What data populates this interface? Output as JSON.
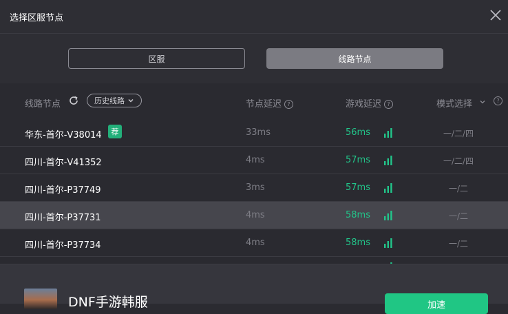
{
  "window": {
    "title": "选择区服节点"
  },
  "tabs": [
    {
      "label": "区服",
      "active": false
    },
    {
      "label": "线路节点",
      "active": true
    }
  ],
  "list_header": {
    "route_label": "线路节点",
    "history_label": "历史线路",
    "node_latency_label": "节点延迟",
    "game_latency_label": "游戏延迟",
    "mode_label": "模式选择",
    "help_glyph": "?"
  },
  "rows": [
    {
      "name": "华东-首尔-V38014",
      "recommended": true,
      "badge": "荐",
      "node_latency": "33ms",
      "game_latency": "56ms",
      "mode": "一/二/四",
      "highlighted": false
    },
    {
      "name": "四川-首尔-V41352",
      "recommended": false,
      "node_latency": "4ms",
      "game_latency": "57ms",
      "mode": "一/二/四",
      "highlighted": false
    },
    {
      "name": "四川-首尔-P37749",
      "recommended": false,
      "node_latency": "3ms",
      "game_latency": "57ms",
      "mode": "一/二",
      "highlighted": false
    },
    {
      "name": "四川-首尔-P37731",
      "recommended": false,
      "node_latency": "4ms",
      "game_latency": "58ms",
      "mode": "一/二",
      "highlighted": true
    },
    {
      "name": "四川-首尔-P37734",
      "recommended": false,
      "node_latency": "4ms",
      "game_latency": "58ms",
      "mode": "一/二",
      "highlighted": false
    }
  ],
  "footer": {
    "game_name": "DNF手游韩服",
    "accelerate_label": "加速"
  },
  "colors": {
    "accent_green": "#22c58a",
    "badge_green": "#23b07a",
    "active_tab": "#7b7b82"
  },
  "icons": {
    "close": "close-icon",
    "refresh": "refresh-icon",
    "history_chevron": "chevron-down-icon",
    "help": "help-circle-icon",
    "signal": "signal-bars-icon"
  }
}
